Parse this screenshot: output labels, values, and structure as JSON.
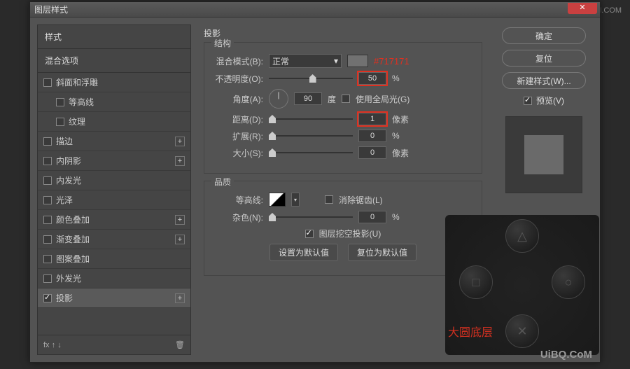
{
  "watermark_top": "思缘设计论坛 WWW.MISSYUAN.COM",
  "watermark_br": "UiBQ.CoM",
  "dialog": {
    "title": "图层样式",
    "close": "✕"
  },
  "left": {
    "header1": "样式",
    "header2": "混合选项",
    "items": [
      {
        "label": "斜面和浮雕",
        "checked": false,
        "plus": false
      },
      {
        "label": "等高线",
        "checked": false,
        "sub": true
      },
      {
        "label": "纹理",
        "checked": false,
        "sub": true
      },
      {
        "label": "描边",
        "checked": false,
        "plus": true
      },
      {
        "label": "内阴影",
        "checked": false,
        "plus": true
      },
      {
        "label": "内发光",
        "checked": false
      },
      {
        "label": "光泽",
        "checked": false
      },
      {
        "label": "颜色叠加",
        "checked": false,
        "plus": true
      },
      {
        "label": "渐变叠加",
        "checked": false,
        "plus": true
      },
      {
        "label": "图案叠加",
        "checked": false
      },
      {
        "label": "外发光",
        "checked": false
      },
      {
        "label": "投影",
        "checked": true,
        "plus": true,
        "selected": true
      }
    ],
    "footer_fx": "fx",
    "footer_trash": "🗑"
  },
  "center": {
    "title": "投影",
    "struct_legend": "结构",
    "blend_label": "混合模式(B):",
    "blend_value": "正常",
    "color_annot": "#717171",
    "opacity_label": "不透明度(O):",
    "opacity_value": "50",
    "percent": "%",
    "angle_label": "角度(A):",
    "angle_value": "90",
    "degree": "度",
    "global_light": "使用全局光(G)",
    "distance_label": "距离(D):",
    "distance_value": "1",
    "px": "像素",
    "spread_label": "扩展(R):",
    "spread_value": "0",
    "size_label": "大小(S):",
    "size_value": "0",
    "quality_legend": "品质",
    "contour_label": "等高线:",
    "antialias": "消除锯齿(L)",
    "noise_label": "杂色(N):",
    "noise_value": "0",
    "knockout": "图层挖空投影(U)",
    "set_default": "设置为默认值",
    "reset_default": "复位为默认值"
  },
  "right": {
    "ok": "确定",
    "cancel": "复位",
    "new_style": "新建样式(W)...",
    "preview": "预览(V)"
  },
  "dpad": {
    "label": "大圆底层",
    "up": "△",
    "left": "□",
    "right": "○",
    "down": "✕"
  }
}
